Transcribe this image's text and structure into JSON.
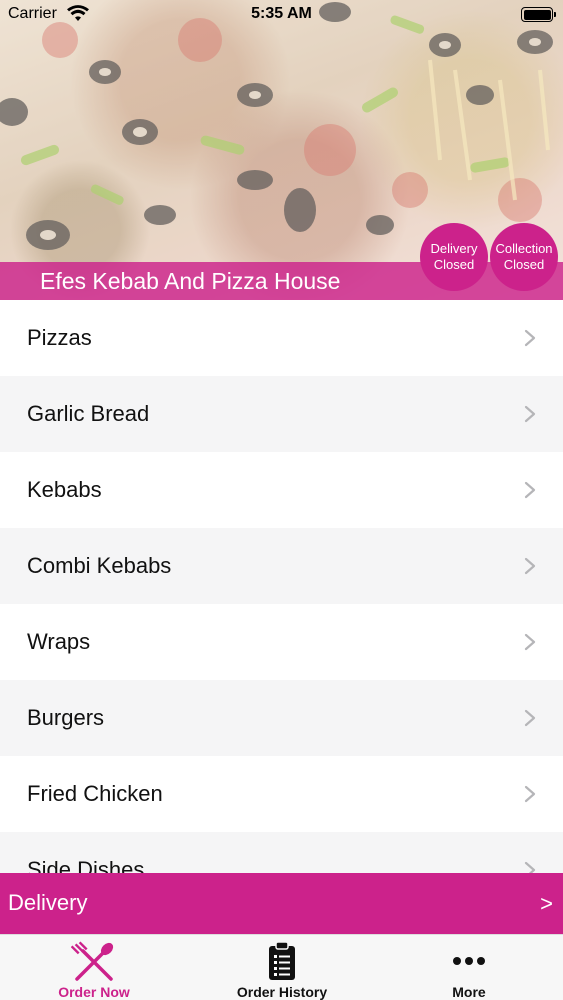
{
  "status_bar": {
    "carrier": "Carrier",
    "time": "5:35 AM"
  },
  "restaurant": {
    "name": "Efes Kebab And Pizza House",
    "delivery_status": {
      "line1": "Delivery",
      "line2": "Closed"
    },
    "collection_status": {
      "line1": "Collection",
      "line2": "Closed"
    }
  },
  "menu": {
    "items": [
      {
        "label": "Pizzas"
      },
      {
        "label": "Garlic Bread"
      },
      {
        "label": "Kebabs"
      },
      {
        "label": "Combi Kebabs"
      },
      {
        "label": "Wraps"
      },
      {
        "label": "Burgers"
      },
      {
        "label": "Fried Chicken"
      },
      {
        "label": "Side Dishes"
      }
    ]
  },
  "delivery_bar": {
    "label": "Delivery",
    "arrow": ">"
  },
  "tabbar": {
    "tabs": [
      {
        "label": "Order Now",
        "icon": "fork-knife-icon",
        "active": true
      },
      {
        "label": "Order History",
        "icon": "clipboard-list-icon",
        "active": false
      },
      {
        "label": "More",
        "icon": "more-dots-icon",
        "active": false
      }
    ]
  },
  "colors": {
    "accent": "#cc228b",
    "list_alt_row": "#f5f5f6",
    "tabbar_bg": "#f7f7f7"
  }
}
